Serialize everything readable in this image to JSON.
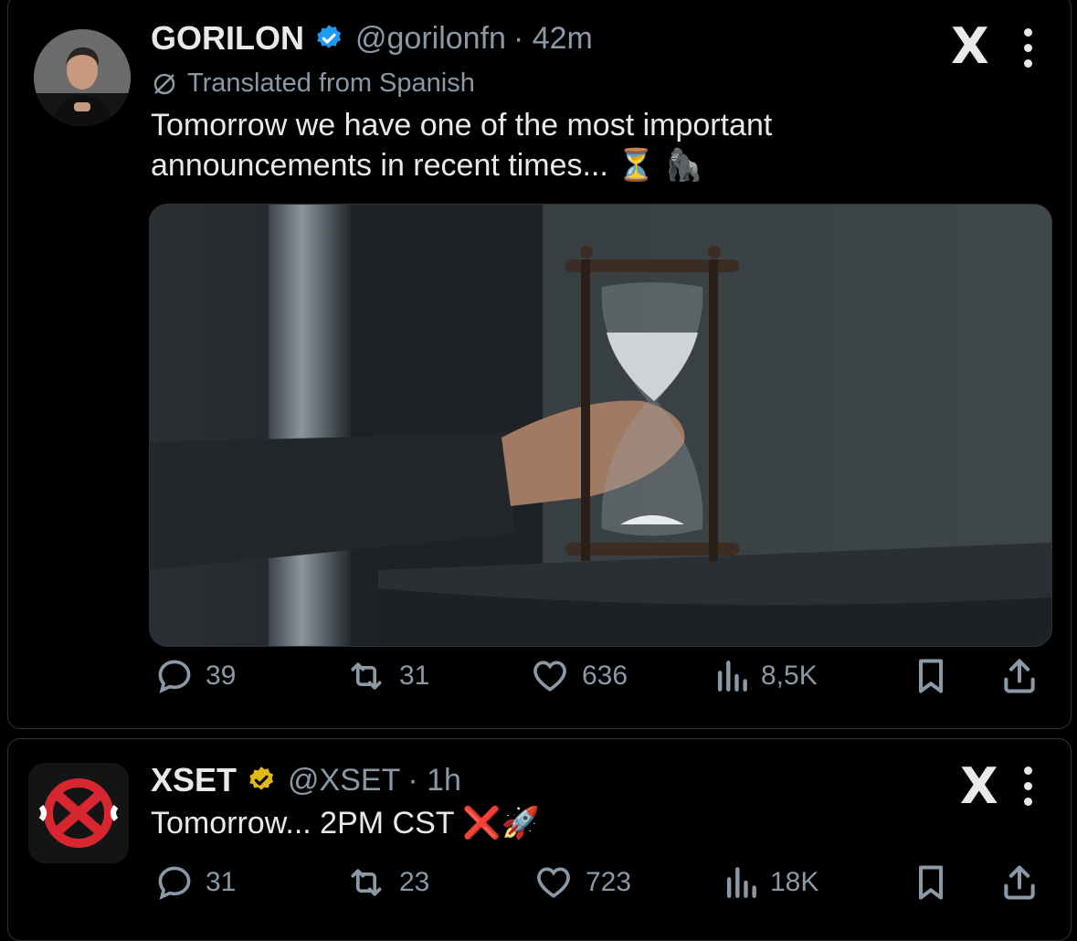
{
  "tweets": [
    {
      "name": "GORILON",
      "handle": "@gorilonfn",
      "time": "· 42m",
      "translated": "Translated from Spanish",
      "text_line1": "Tomorrow we have one of the most important",
      "text_line2": "announcements in recent times... ⏳ 🦍",
      "verified_color": "#1d9bf0",
      "replies": "39",
      "reposts": "31",
      "likes": "636",
      "views": "8,5K",
      "logo": "X",
      "media_icon": "hourglass-photo"
    },
    {
      "name": "XSET",
      "handle": "@XSET",
      "time": "· 1h",
      "text": "Tomorrow... 2PM CST ❌🚀",
      "verified_color": "#e2b719",
      "replies": "31",
      "reposts": "23",
      "likes": "723",
      "views": "18K",
      "logo": "X"
    }
  ],
  "colors": {
    "background": "#000000",
    "muted": "#8b98a5",
    "text": "#e7e9ea",
    "border": "#2f3336",
    "xset_red": "#d7262f"
  }
}
